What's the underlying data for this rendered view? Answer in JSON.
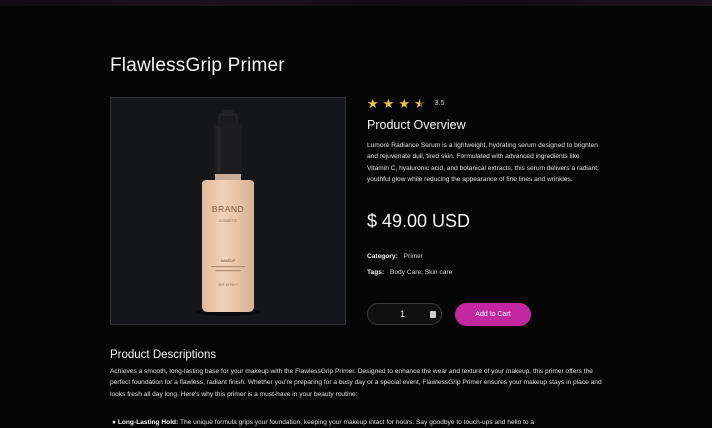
{
  "product": {
    "title": "FlawlessGrip Primer",
    "image_alt": "Cosmetic foundation bottle",
    "bottle_brand": "BRAND",
    "bottle_sub": "COSMETIC",
    "bottle_type": "MAKEUP",
    "bottle_spf": "SPF 15 PA++",
    "rating": {
      "value": "3.5",
      "stars_filled": 3,
      "stars_half": 1,
      "stars_total": 4
    },
    "overview_heading": "Product Overview",
    "overview_text": "Lumoré Radiance Serum is a lightweight, hydrating serum designed to brighten and rejuvenate dull, tired skin. Formulated with advanced ingredients like Vitamin C, hyaluronic acid, and botanical extracts, this serum delivers a radiant, youthful glow while reducing the appearance of fine lines and wrinkles.",
    "price": "$ 49.00 USD",
    "category_label": "Category:",
    "category_value": "Primer",
    "tags_label": "Tags:",
    "tags_value": "Body Care, Skin care",
    "quantity": "1",
    "add_to_cart": "Add to Cart"
  },
  "descriptions": {
    "heading": "Product Descriptions",
    "text": "Achieves a smooth, long-lasting base for your makeup with the FlawlessGrip Primer. Designed to enhance the wear and texture of your makeup, this primer offers the perfect foundation for a flawless, radiant finish. Whether you're preparing for a busy day or a special event, FlawlessGrip Primer ensures your makeup stays in place and looks fresh all day long. Here's why this primer is a must-have in your beauty routine:",
    "bullet_title": "Long-Lasting Hold:",
    "bullet_text": "The unique formula grips your foundation, keeping your makeup intact for hours. Say goodbye to touch-ups and hello to a"
  },
  "colors": {
    "background": "#050505",
    "accent": "#c3279f",
    "star": "#f3c43b"
  }
}
